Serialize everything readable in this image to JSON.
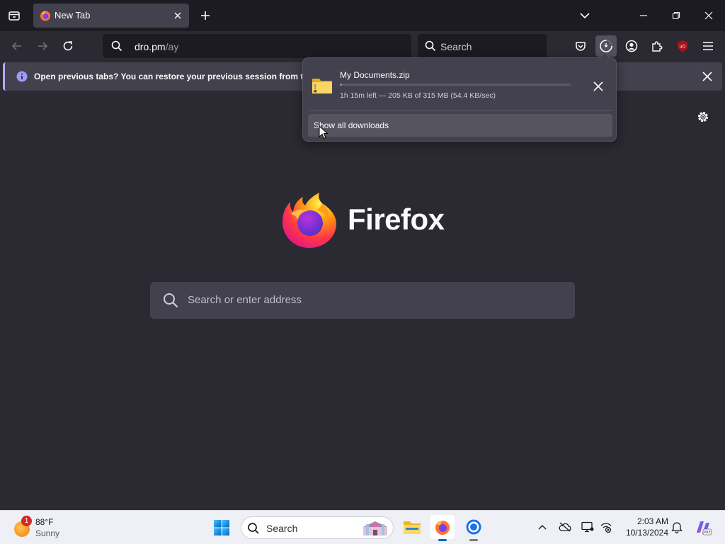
{
  "tabstrip": {
    "tab_title": "New Tab"
  },
  "navbar": {
    "url_host": "dro.pm",
    "url_path": "/ay",
    "search_placeholder": "Search"
  },
  "notification": {
    "text": "Open previous tabs? You can restore your previous session from the Firefox application menu"
  },
  "downloads_panel": {
    "file_name": "My Documents.zip",
    "status": "1h 15m left — 205 KB of 315 MB (54.4 KB/sec)",
    "progress_fraction": 0.00065,
    "show_all_label": "Show all downloads"
  },
  "content": {
    "brand_word": "Firefox",
    "search_placeholder": "Search or enter address"
  },
  "taskbar": {
    "weather_badge": "1",
    "weather_temp": "88°F",
    "weather_condition": "Sunny",
    "search_label": "Search",
    "time": "2:03 AM",
    "date": "10/13/2024"
  },
  "colors": {
    "toolbar_bg": "#2b2a33",
    "tabstrip_bg": "#1c1b22",
    "panel_bg": "#42414d",
    "notif_accent": "#b8a8ff",
    "taskbar_bg": "#eef0f6"
  },
  "icons": [
    "tab-list-icon",
    "firefox-favicon",
    "close-icon",
    "plus-icon",
    "chevron-down-icon",
    "minimize-icon",
    "restore-icon",
    "back-icon",
    "forward-icon",
    "reload-icon",
    "search-icon",
    "pocket-icon",
    "downloads-icon",
    "account-icon",
    "extensions-icon",
    "ublock-icon",
    "menu-icon",
    "info-icon",
    "gear-icon",
    "zip-folder-icon",
    "windows-start-icon",
    "file-explorer-icon",
    "firefox-icon",
    "chrome-icon",
    "chevron-up-icon",
    "onedrive-icon",
    "display-icon",
    "network-icon",
    "bell-icon",
    "copilot-icon"
  ]
}
